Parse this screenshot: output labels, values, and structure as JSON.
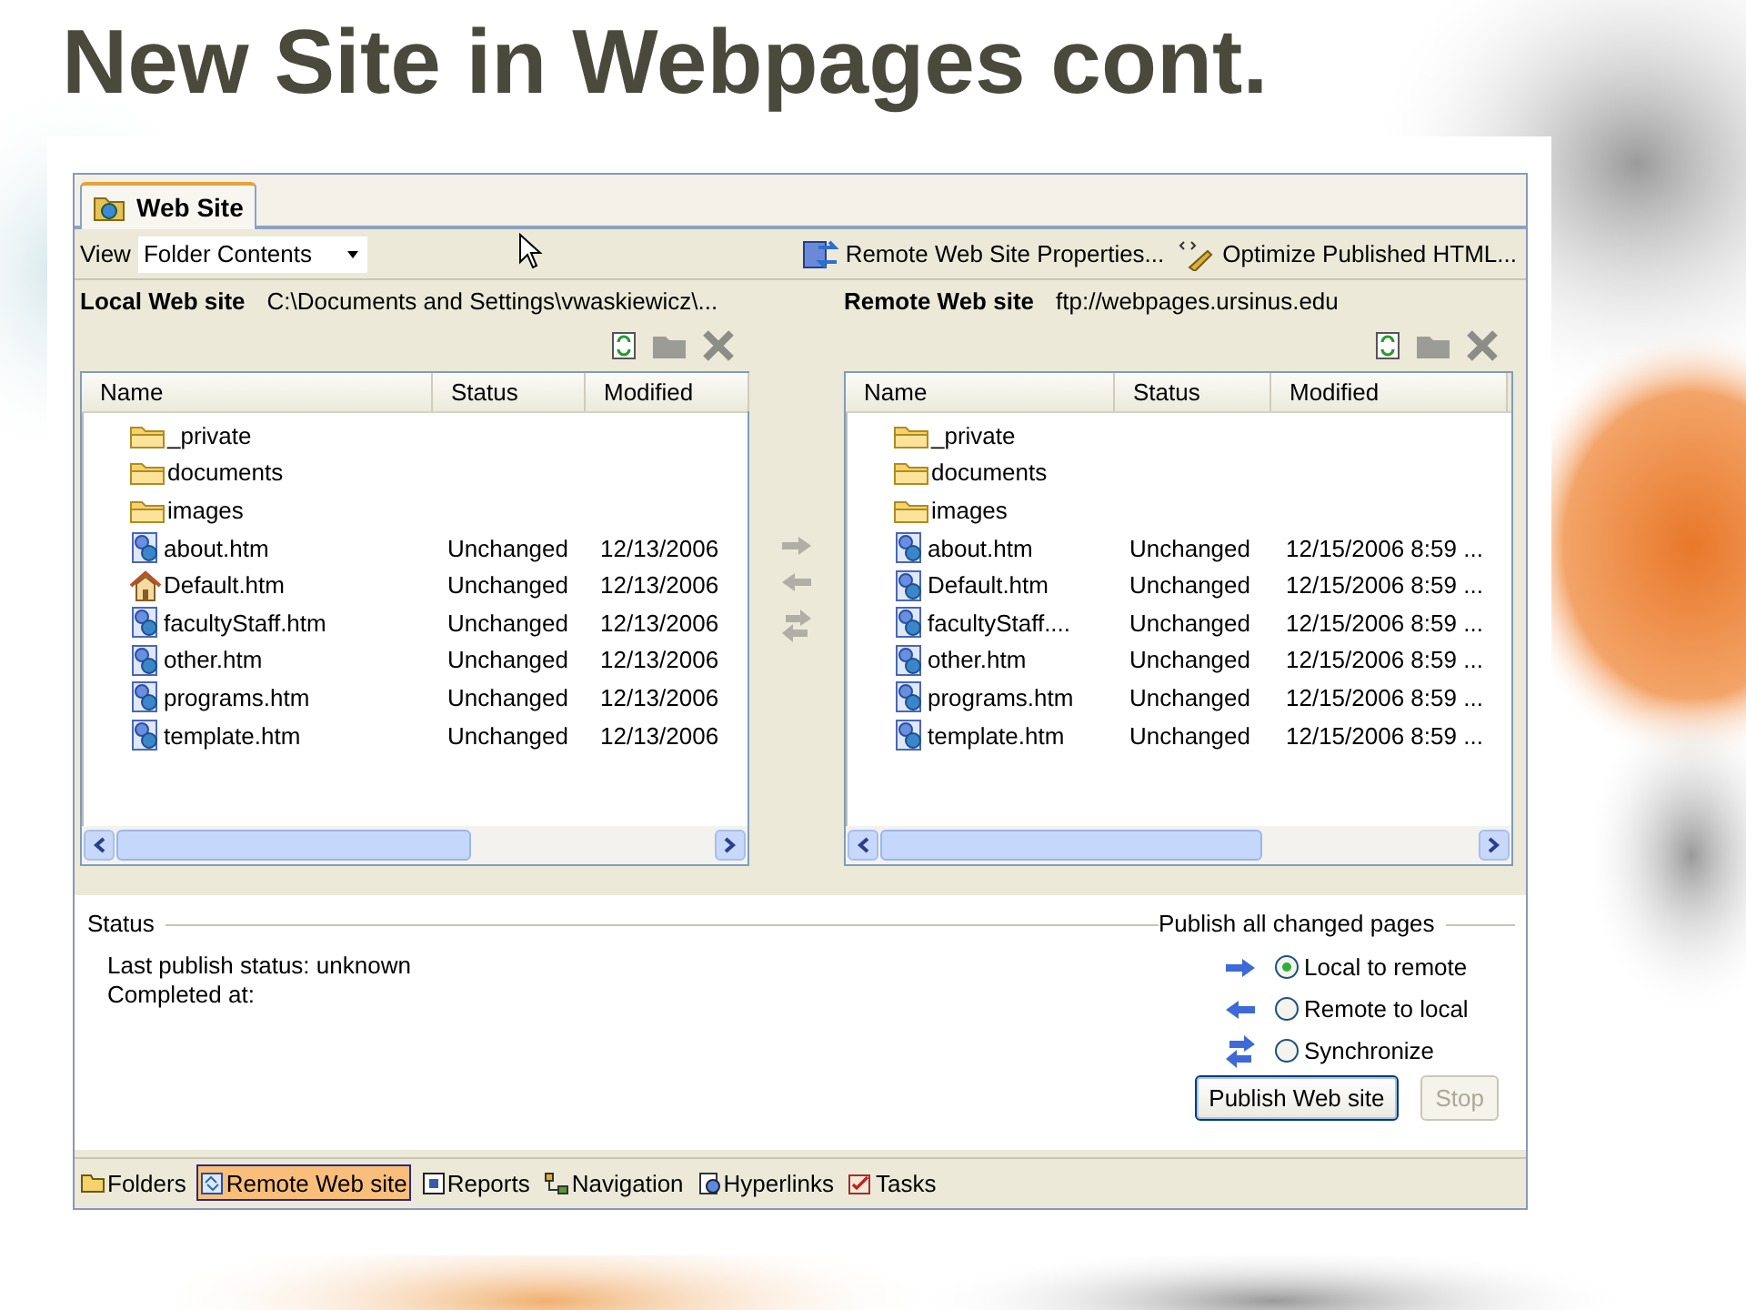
{
  "slide": {
    "title": "New Site in Webpages cont."
  },
  "window": {
    "tab": {
      "label": "Web Site",
      "selected": true
    },
    "toolbar": {
      "view_label": "View",
      "view_value": "Folder Contents",
      "actions": [
        {
          "kind": "properties",
          "label": "Remote Web Site Properties..."
        },
        {
          "kind": "optimize",
          "label": "Optimize Published HTML..."
        }
      ]
    },
    "panes": [
      {
        "label": "Local Web site",
        "path": "C:\\Documents and Settings\\vwaskiewicz\\...",
        "columns": [
          "Name",
          "Status",
          "Modified"
        ],
        "rows": [
          {
            "kind": "folder",
            "name": "_private"
          },
          {
            "kind": "folder",
            "name": "documents"
          },
          {
            "kind": "folder",
            "name": "images"
          },
          {
            "kind": "page",
            "name": "about.htm",
            "status": "Unchanged",
            "modified": "12/13/2006"
          },
          {
            "kind": "home",
            "name": "Default.htm",
            "status": "Unchanged",
            "modified": "12/13/2006"
          },
          {
            "kind": "page",
            "name": "facultyStaff.htm",
            "status": "Unchanged",
            "modified": "12/13/2006"
          },
          {
            "kind": "page",
            "name": "other.htm",
            "status": "Unchanged",
            "modified": "12/13/2006"
          },
          {
            "kind": "page",
            "name": "programs.htm",
            "status": "Unchanged",
            "modified": "12/13/2006"
          },
          {
            "kind": "page",
            "name": "template.htm",
            "status": "Unchanged",
            "modified": "12/13/2006"
          }
        ]
      },
      {
        "label": "Remote Web site",
        "path": "ftp://webpages.ursinus.edu",
        "columns": [
          "Name",
          "Status",
          "Modified"
        ],
        "rows": [
          {
            "kind": "folder",
            "name": "_private"
          },
          {
            "kind": "folder",
            "name": "documents"
          },
          {
            "kind": "folder",
            "name": "images"
          },
          {
            "kind": "page",
            "name": "about.htm",
            "status": "Unchanged",
            "modified": "12/15/2006 8:59 ..."
          },
          {
            "kind": "page",
            "name": "Default.htm",
            "status": "Unchanged",
            "modified": "12/15/2006 8:59 ..."
          },
          {
            "kind": "page",
            "name": "facultyStaff....",
            "status": "Unchanged",
            "modified": "12/15/2006 8:59 ..."
          },
          {
            "kind": "page",
            "name": "other.htm",
            "status": "Unchanged",
            "modified": "12/15/2006 8:59 ..."
          },
          {
            "kind": "page",
            "name": "programs.htm",
            "status": "Unchanged",
            "modified": "12/15/2006 8:59 ..."
          },
          {
            "kind": "page",
            "name": "template.htm",
            "status": "Unchanged",
            "modified": "12/15/2006 8:59 ..."
          }
        ]
      }
    ],
    "status": {
      "heading": "Status",
      "lines": [
        "Last publish status: unknown",
        "Completed at:"
      ]
    },
    "publish": {
      "heading": "Publish all changed pages",
      "options": [
        {
          "kind": "right",
          "label": "Local to remote",
          "selected": true
        },
        {
          "kind": "left",
          "label": "Remote to local",
          "selected": false
        },
        {
          "kind": "both",
          "label": "Synchronize",
          "selected": false
        }
      ],
      "buttons": [
        {
          "label": "Publish Web site",
          "disabled": false
        },
        {
          "label": "Stop",
          "disabled": true
        }
      ]
    },
    "view_tabs": [
      {
        "kind": "folders",
        "label": "Folders",
        "selected": false
      },
      {
        "kind": "remote",
        "label": "Remote Web site",
        "selected": true
      },
      {
        "kind": "reports",
        "label": "Reports",
        "selected": false
      },
      {
        "kind": "navigation",
        "label": "Navigation",
        "selected": false
      },
      {
        "kind": "hyperlinks",
        "label": "Hyperlinks",
        "selected": false
      },
      {
        "kind": "tasks",
        "label": "Tasks",
        "selected": false
      }
    ]
  }
}
